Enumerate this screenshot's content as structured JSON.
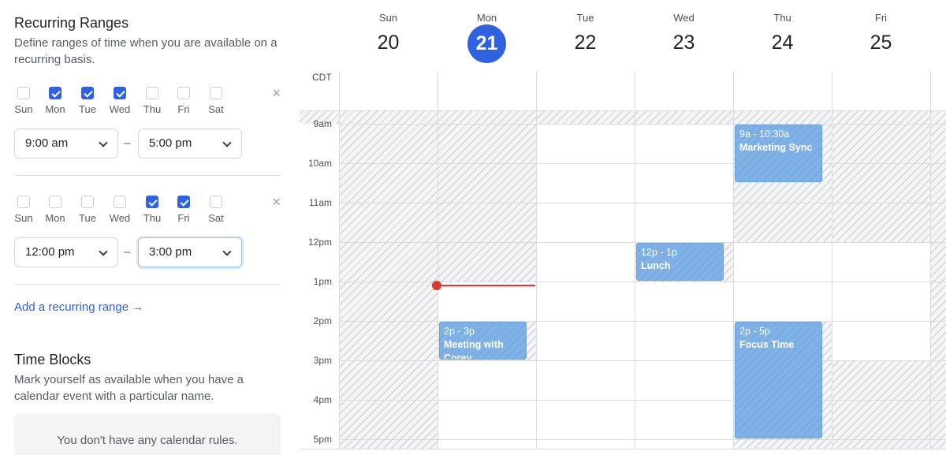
{
  "recurring": {
    "title": "Recurring Ranges",
    "description": "Define ranges of time when you are available on a recurring basis.",
    "day_labels": [
      "Sun",
      "Mon",
      "Tue",
      "Wed",
      "Thu",
      "Fri",
      "Sat"
    ],
    "ranges": [
      {
        "checked": [
          false,
          true,
          true,
          true,
          false,
          false,
          false
        ],
        "start": "9:00 am",
        "end": "5:00 pm",
        "separator": "–",
        "remove": "×"
      },
      {
        "checked": [
          false,
          false,
          false,
          false,
          true,
          true,
          false
        ],
        "start": "12:00 pm",
        "end": "3:00 pm",
        "separator": "–",
        "remove": "×"
      }
    ],
    "add_label": "Add a recurring range →"
  },
  "blocks": {
    "title": "Time Blocks",
    "description": "Mark yourself as available when you have a calendar event with a particular name.",
    "empty": "You don't have any calendar rules."
  },
  "calendar": {
    "timezone": "CDT",
    "days": [
      {
        "dow": "Sun",
        "date": "20",
        "today": false
      },
      {
        "dow": "Mon",
        "date": "21",
        "today": true
      },
      {
        "dow": "Tue",
        "date": "22",
        "today": false
      },
      {
        "dow": "Wed",
        "date": "23",
        "today": false
      },
      {
        "dow": "Thu",
        "date": "24",
        "today": false
      },
      {
        "dow": "Fri",
        "date": "25",
        "today": false
      }
    ],
    "hours": [
      "9am",
      "10am",
      "11am",
      "12pm",
      "1pm",
      "2pm",
      "3pm",
      "4pm",
      "5pm"
    ],
    "events": [
      {
        "time": "9a - 10:30a",
        "title": "Marketing Sync"
      },
      {
        "time": "12p - 1p",
        "title": "Lunch"
      },
      {
        "time": "2p - 3p",
        "title": "Meeting with Corey"
      },
      {
        "time": "2p - 5p",
        "title": "Focus Time"
      }
    ],
    "colors": {
      "accent": "#2f62e0",
      "event": "#7aaee4",
      "now": "#d93a32"
    }
  }
}
